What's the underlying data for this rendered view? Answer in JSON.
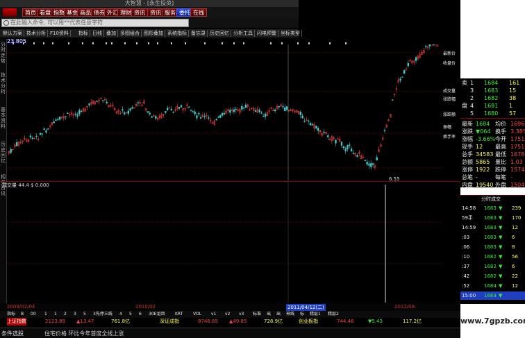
{
  "window": {
    "title": "大智慧 - [永生投资]"
  },
  "menu": [
    {
      "label": "首页"
    },
    {
      "label": "看盘"
    },
    {
      "label": "指数"
    },
    {
      "label": "基金"
    },
    {
      "label": "商品"
    },
    {
      "label": "债券"
    },
    {
      "label": "外汇"
    },
    {
      "label": "理财"
    },
    {
      "label": "资讯"
    },
    {
      "label": "资讯"
    },
    {
      "label": "服务"
    },
    {
      "label": "委托"
    },
    {
      "label": "在线"
    }
  ],
  "search": {
    "placeholder": "在此输入命令, 可以用**代表任意字符"
  },
  "toolbar": [
    "默认方案",
    "技术分析",
    "F10资料",
    "指标",
    "日线",
    "叠加",
    "多图组合",
    "图形叠加",
    "系统指标",
    "备忘录",
    "历史回忆",
    "分析工具",
    "闪电预警",
    "坐标类型"
  ],
  "left_tabs": [
    "分时走势",
    "技术分析",
    "基本资料",
    "历史回忆",
    "相关资讯"
  ],
  "chart": {
    "price_label": "23.805",
    "low_label": "6.55",
    "volume_label": "成交量 44.4 $ 0.000"
  },
  "right_panel": [
    "最新价",
    "收盘价",
    "成交量",
    "张跌幅",
    "涨跌额",
    "振幅",
    "换手率"
  ],
  "orderbook": [
    {
      "label": "卖",
      "n": "1",
      "price": "1684",
      "vol": "161"
    },
    {
      "label": "",
      "n": "3",
      "price": "1683",
      "vol": "15"
    },
    {
      "label": "",
      "n": "2",
      "price": "1682",
      "vol": "38"
    },
    {
      "label": "盘",
      "n": "4",
      "price": "1681",
      "vol": "1"
    },
    {
      "label": "",
      "n": "5",
      "price": "1680",
      "vol": "57"
    }
  ],
  "stats": [
    {
      "k": "最新",
      "v": "1684",
      "k2": "均价",
      "v2": "1696"
    },
    {
      "k": "涨跌",
      "v": "▼064",
      "k2": "换手",
      "v2": "3.38%"
    },
    {
      "k": "涨幅",
      "v": "-3.66%",
      "k2": "今开",
      "v2": "1751"
    },
    {
      "k": "现手",
      "v": "12",
      "k2": "最高",
      "v2": "1751"
    },
    {
      "k": "总手",
      "v": "34583",
      "k2": "最低",
      "v2": "1678"
    },
    {
      "k": "总额",
      "v": "5865",
      "k2": "量比",
      "v2": "1.03"
    },
    {
      "k": "涨停",
      "v": "1922",
      "k2": "跌停",
      "v2": "1574"
    },
    {
      "k": "总笔",
      "v": "-",
      "k2": "每笔",
      "v2": "-"
    },
    {
      "k": "内盘",
      "v": "19540",
      "k2": "外盘",
      "v2": "15043"
    }
  ],
  "ticks_header": "分时成交",
  "ticks": [
    {
      "t": "14:58",
      "p": "1683",
      "v": "239"
    },
    {
      "t": "59手",
      "p": "1683",
      "v": "170"
    },
    {
      "t": "14:59",
      "p": "1683",
      "v": "12"
    },
    {
      "t": ":03",
      "p": "1683",
      "v": "6"
    },
    {
      "t": ":06",
      "p": "1683",
      "v": "8"
    },
    {
      "t": ":10",
      "p": "1682",
      "v": "56"
    },
    {
      "t": ":37",
      "p": "1682",
      "v": "6"
    },
    {
      "t": ":42",
      "p": "1682",
      "v": "22"
    },
    {
      "t": ":52",
      "p": "1684",
      "v": "12"
    },
    {
      "t": "15:00",
      "p": "1683",
      "v": ""
    }
  ],
  "datebar": {
    "left": "2009/02/04",
    "mid": "2010/02",
    "cursor": "2011/04/12(二)",
    "right": "2012/08"
  },
  "bottom_tabs": [
    "指标",
    "B",
    "00",
    "1",
    "1",
    "2",
    "3",
    "5",
    "3先停三线",
    "4",
    "5",
    "6",
    "30E龙回",
    "KRT",
    "VOL",
    "v1",
    "v2",
    "v3",
    "标准",
    "出",
    "出",
    "神线",
    "标",
    "精层1",
    "精层2"
  ],
  "index_bar": [
    {
      "name": "上证指数",
      "val": "2123.85",
      "chg": "▲13.47",
      "amt": "761.8亿"
    },
    {
      "name": "深证成指",
      "val": "8748.85",
      "chg": "▲49.85",
      "amt": "728.9亿"
    },
    {
      "name": "创业板指",
      "val": "744.46",
      "chg": "▼5.43",
      "amt": "117.2亿"
    }
  ],
  "status": {
    "left": "条件选股",
    "news": "住宅价格 环比今年首度全线上涨"
  },
  "watermark": "www.7gpzb.com",
  "colors": {
    "up": "#ff4040",
    "down": "#33ee33",
    "accent": "#1f3fbf"
  }
}
